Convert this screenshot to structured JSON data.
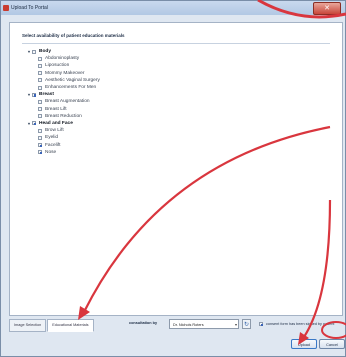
{
  "window": {
    "title": "Upload To Portal",
    "close_label": "✕"
  },
  "panel": {
    "heading": "Select availability of patient education materials",
    "groups": [
      {
        "label": "Body",
        "checked": false,
        "items": [
          {
            "label": "Abdominoplasty",
            "checked": false
          },
          {
            "label": "Liposuction",
            "checked": false
          },
          {
            "label": "Mommy Makeover",
            "checked": false
          },
          {
            "label": "Aesthetic Vaginal Surgery",
            "checked": false
          },
          {
            "label": "Enhancements For Men",
            "checked": false
          }
        ]
      },
      {
        "label": "Breast",
        "checked": true,
        "items": [
          {
            "label": "Breast Augmentation",
            "checked": false
          },
          {
            "label": "Breast Lift",
            "checked": false
          },
          {
            "label": "Breast Reduction",
            "checked": false
          }
        ]
      },
      {
        "label": "Head and Face",
        "checked": true,
        "items": [
          {
            "label": "Brow Lift",
            "checked": false
          },
          {
            "label": "Eyelid",
            "checked": false
          },
          {
            "label": "Facelift",
            "checked": true
          },
          {
            "label": "Nose",
            "checked": true
          }
        ]
      }
    ]
  },
  "tabs": [
    {
      "label": "Image Selection",
      "active": false
    },
    {
      "label": "Educational Materials",
      "active": true
    }
  ],
  "consultation": {
    "label": "consultation by",
    "selected": "Dr. Nichols Roters"
  },
  "consent": {
    "label": "consent form has been signed by patient",
    "checked": true
  },
  "buttons": {
    "upload": "Upload",
    "cancel": "Cancel"
  },
  "colors": {
    "annotation_arrow": "#d9363e",
    "accent": "#3a64b8"
  }
}
